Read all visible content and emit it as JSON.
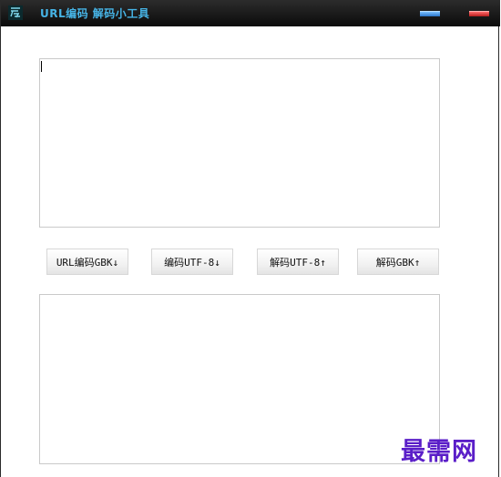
{
  "window": {
    "title": "URL编码 解码小工具",
    "app_icon": "app-logo-icon",
    "controls": {
      "minimize_icon": "minimize-icon",
      "close_icon": "close-icon",
      "minimize_color": "#2a74c9",
      "close_color": "#b41c1c"
    }
  },
  "input": {
    "value": "",
    "placeholder": ""
  },
  "output": {
    "value": "",
    "placeholder": ""
  },
  "buttons": {
    "encode_gbk": "URL编码GBK↓",
    "encode_utf8": "编码UTF-8↓",
    "decode_utf8": "解码UTF-8↑",
    "decode_gbk": "解码GBK↑"
  },
  "watermark": {
    "text": "最需网",
    "color": "#5a1ec8"
  }
}
